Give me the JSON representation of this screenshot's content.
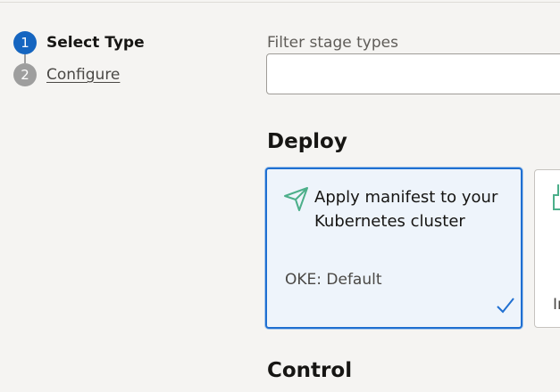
{
  "steps": [
    {
      "number": "1",
      "label": "Select Type",
      "state": "active"
    },
    {
      "number": "2",
      "label": "Configure",
      "state": "inactive"
    }
  ],
  "filter": {
    "label": "Filter stage types",
    "value": "",
    "placeholder": ""
  },
  "sections": {
    "deploy": {
      "heading": "Deploy",
      "cards": [
        {
          "title": "Apply manifest to your Kubernetes cluster",
          "subtitle": "OKE: Default",
          "icon": "send-icon",
          "selected": true
        },
        {
          "title": "",
          "subtitle": "In",
          "icon": "cube-icon",
          "selected": false
        }
      ]
    },
    "control": {
      "heading": "Control"
    }
  },
  "colors": {
    "accent": "#1565c0",
    "selected_border": "#1f6fd1",
    "selected_bg": "#eef4fb",
    "step_inactive": "#9e9e9e",
    "icon_green": "#4caf8a"
  }
}
